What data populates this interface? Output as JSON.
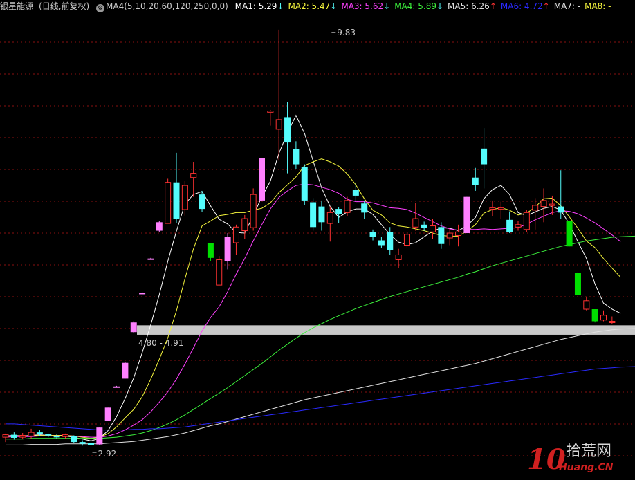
{
  "header": {
    "stock": "银星能源",
    "period": "(日线,前复权)",
    "gear_icon": "gear-icon",
    "params": "MA4(5,10,20,60,120,250,0,0)",
    "ma_items": [
      {
        "label": "MA1: 5.29",
        "arrow": "↓",
        "color": "#ffffff"
      },
      {
        "label": "MA2: 5.47",
        "arrow": "↓",
        "color": "#f5f53c"
      },
      {
        "label": "MA3: 5.62",
        "arrow": "↓",
        "color": "#ff40ff"
      },
      {
        "label": "MA4: 5.89",
        "arrow": "↓",
        "color": "#3cf03c"
      },
      {
        "label": "MA5: 6.26",
        "arrow": "↑",
        "color": "#e0e0e0"
      },
      {
        "label": "MA6: 4.72",
        "arrow": "↑",
        "color": "#2a2aff"
      },
      {
        "label": "MA7: -",
        "arrow": "",
        "color": "#e0e0e0"
      },
      {
        "label": "MA8: -",
        "arrow": "",
        "color": "#f5f53c"
      }
    ]
  },
  "chart_data": {
    "type": "candlestick",
    "ylim": [
      2.6,
      10.0
    ],
    "grid": true,
    "colors": {
      "up": "#ff3232",
      "down": "#54fcfc",
      "limit_up": "#ff80ff",
      "limit_down": "#00e000",
      "arrow_up": "#ff3232",
      "arrow_down": "#54fcfc",
      "band": "#c8c8c8",
      "annotation": "#c8c8c8"
    },
    "annotations": [
      {
        "label": "9.83",
        "value": 9.83,
        "candle": 38
      },
      {
        "label": "2.92",
        "value": 2.92,
        "candle": 10
      }
    ],
    "band": {
      "label": "4.80 - 4.91",
      "low": 4.8,
      "high": 4.91
    },
    "candles": [
      {
        "o": 3.08,
        "h": 3.14,
        "l": 3.0,
        "c": 3.12,
        "s": "up"
      },
      {
        "o": 3.12,
        "h": 3.16,
        "l": 3.04,
        "c": 3.07,
        "s": "down"
      },
      {
        "o": 3.08,
        "h": 3.15,
        "l": 3.05,
        "c": 3.11,
        "s": "up"
      },
      {
        "o": 3.1,
        "h": 3.22,
        "l": 3.06,
        "c": 3.16,
        "s": "up"
      },
      {
        "o": 3.16,
        "h": 3.2,
        "l": 3.1,
        "c": 3.13,
        "s": "down"
      },
      {
        "o": 3.13,
        "h": 3.14,
        "l": 3.08,
        "c": 3.11,
        "s": "down"
      },
      {
        "o": 3.1,
        "h": 3.13,
        "l": 3.05,
        "c": 3.08,
        "s": "down"
      },
      {
        "o": 3.09,
        "h": 3.14,
        "l": 3.06,
        "c": 3.12,
        "s": "up"
      },
      {
        "o": 3.1,
        "h": 3.11,
        "l": 2.98,
        "c": 3.0,
        "s": "down"
      },
      {
        "o": 3.0,
        "h": 3.03,
        "l": 2.94,
        "c": 2.97,
        "s": "down"
      },
      {
        "o": 2.98,
        "h": 3.0,
        "l": 2.92,
        "c": 2.95,
        "s": "down"
      },
      {
        "o": 2.96,
        "h": 3.24,
        "l": 2.95,
        "c": 3.24,
        "s": "limit_up"
      },
      {
        "o": 3.35,
        "h": 3.57,
        "l": 3.35,
        "c": 3.57,
        "s": "limit_up"
      },
      {
        "o": 3.92,
        "h": 3.93,
        "l": 3.9,
        "c": 3.92,
        "s": "limit_up"
      },
      {
        "o": 4.05,
        "h": 4.32,
        "l": 4.05,
        "c": 4.31,
        "s": "limit_up"
      },
      {
        "o": 4.82,
        "h": 5.0,
        "l": 4.8,
        "c": 4.98,
        "s": "limit_up"
      },
      {
        "o": 5.46,
        "h": 5.48,
        "l": 5.46,
        "c": 5.47,
        "s": "limit_up"
      },
      {
        "o": 6.02,
        "h": 6.05,
        "l": 6.02,
        "c": 6.04,
        "s": "limit_up"
      },
      {
        "o": 6.5,
        "h": 6.66,
        "l": 6.48,
        "c": 6.64,
        "s": "limit_up"
      },
      {
        "o": 6.62,
        "h": 7.36,
        "l": 6.62,
        "c": 7.3,
        "s": "up"
      },
      {
        "o": 7.3,
        "h": 7.79,
        "l": 6.63,
        "c": 6.7,
        "s": "down"
      },
      {
        "o": 6.85,
        "h": 7.33,
        "l": 6.75,
        "c": 7.25,
        "s": "up"
      },
      {
        "o": 7.38,
        "h": 7.64,
        "l": 7.06,
        "c": 7.45,
        "s": "up"
      },
      {
        "o": 7.1,
        "h": 7.16,
        "l": 6.81,
        "c": 6.86,
        "s": "down"
      },
      {
        "o": 6.05,
        "h": 6.3,
        "l": 6.0,
        "c": 6.3,
        "s": "limit_down"
      },
      {
        "o": 5.6,
        "h": 6.08,
        "l": 5.6,
        "c": 6.02,
        "s": "up"
      },
      {
        "o": 6.0,
        "h": 6.46,
        "l": 5.86,
        "c": 6.4,
        "s": "limit_up"
      },
      {
        "o": 6.3,
        "h": 6.6,
        "l": 6.1,
        "c": 6.56,
        "s": "up"
      },
      {
        "o": 6.5,
        "h": 6.76,
        "l": 6.36,
        "c": 6.7,
        "s": "up"
      },
      {
        "o": 6.55,
        "h": 7.2,
        "l": 6.5,
        "c": 7.1,
        "s": "up"
      },
      {
        "o": 7.0,
        "h": 7.7,
        "l": 7.0,
        "c": 7.7,
        "s": "limit_up"
      },
      {
        "o": 8.48,
        "h": 8.5,
        "l": 8.24,
        "c": 8.48,
        "s": "up"
      },
      {
        "o": 8.18,
        "h": 9.83,
        "l": 7.66,
        "c": 8.34,
        "s": "up"
      },
      {
        "o": 8.38,
        "h": 8.63,
        "l": 7.45,
        "c": 7.96,
        "s": "down"
      },
      {
        "o": 7.85,
        "h": 7.98,
        "l": 7.52,
        "c": 7.6,
        "s": "down"
      },
      {
        "o": 7.56,
        "h": 7.6,
        "l": 6.93,
        "c": 7.0,
        "s": "down"
      },
      {
        "o": 6.97,
        "h": 7.04,
        "l": 6.5,
        "c": 6.56,
        "s": "down"
      },
      {
        "o": 6.9,
        "h": 7.0,
        "l": 6.5,
        "c": 6.64,
        "s": "down"
      },
      {
        "o": 6.62,
        "h": 6.9,
        "l": 6.32,
        "c": 6.8,
        "s": "up"
      },
      {
        "o": 6.86,
        "h": 6.89,
        "l": 6.63,
        "c": 6.78,
        "s": "down"
      },
      {
        "o": 6.8,
        "h": 7.06,
        "l": 6.74,
        "c": 7.0,
        "s": "up"
      },
      {
        "o": 7.18,
        "h": 7.3,
        "l": 7.0,
        "c": 7.08,
        "s": "down"
      },
      {
        "o": 6.95,
        "h": 7.0,
        "l": 6.7,
        "c": 6.8,
        "s": "down"
      },
      {
        "o": 6.48,
        "h": 6.52,
        "l": 6.34,
        "c": 6.4,
        "s": "down"
      },
      {
        "o": 6.34,
        "h": 6.4,
        "l": 6.22,
        "c": 6.26,
        "s": "down"
      },
      {
        "o": 6.48,
        "h": 6.56,
        "l": 6.1,
        "c": 6.18,
        "s": "down"
      },
      {
        "o": 6.02,
        "h": 6.2,
        "l": 5.88,
        "c": 6.1,
        "s": "up"
      },
      {
        "o": 6.26,
        "h": 6.48,
        "l": 6.22,
        "c": 6.44,
        "s": "up"
      },
      {
        "o": 6.56,
        "h": 6.96,
        "l": 6.5,
        "c": 6.7,
        "s": "up"
      },
      {
        "o": 6.6,
        "h": 6.65,
        "l": 6.5,
        "c": 6.55,
        "s": "down"
      },
      {
        "o": 6.48,
        "h": 6.7,
        "l": 6.36,
        "c": 6.58,
        "s": "up"
      },
      {
        "o": 6.56,
        "h": 6.64,
        "l": 6.2,
        "c": 6.28,
        "s": "down"
      },
      {
        "o": 6.38,
        "h": 6.54,
        "l": 6.26,
        "c": 6.46,
        "s": "up"
      },
      {
        "o": 6.42,
        "h": 6.6,
        "l": 6.24,
        "c": 6.48,
        "s": "up"
      },
      {
        "o": 6.46,
        "h": 7.06,
        "l": 6.46,
        "c": 7.06,
        "s": "limit_up"
      },
      {
        "o": 7.38,
        "h": 7.54,
        "l": 7.16,
        "c": 7.26,
        "s": "down"
      },
      {
        "o": 7.6,
        "h": 8.2,
        "l": 7.2,
        "c": 7.86,
        "s": "down"
      },
      {
        "o": 6.88,
        "h": 7.0,
        "l": 6.74,
        "c": 6.86,
        "s": "up"
      },
      {
        "o": 6.86,
        "h": 6.98,
        "l": 6.7,
        "c": 6.88,
        "s": "up"
      },
      {
        "o": 6.68,
        "h": 6.82,
        "l": 6.46,
        "c": 6.48,
        "s": "down"
      },
      {
        "o": 6.56,
        "h": 6.66,
        "l": 6.5,
        "c": 6.6,
        "s": "up"
      },
      {
        "o": 6.52,
        "h": 6.84,
        "l": 6.48,
        "c": 6.8,
        "s": "up"
      },
      {
        "o": 6.84,
        "h": 7.04,
        "l": 6.52,
        "c": 6.92,
        "s": "up"
      },
      {
        "o": 6.9,
        "h": 7.2,
        "l": 6.64,
        "c": 7.0,
        "s": "up"
      },
      {
        "o": 6.92,
        "h": 7.08,
        "l": 6.76,
        "c": 6.94,
        "s": "up"
      },
      {
        "o": 6.9,
        "h": 7.5,
        "l": 6.7,
        "c": 6.8,
        "s": "down"
      },
      {
        "o": 6.66,
        "h": 6.66,
        "l": 6.24,
        "c": 6.24,
        "s": "limit_down"
      },
      {
        "o": 5.8,
        "h": 5.82,
        "l": 5.42,
        "c": 5.44,
        "s": "limit_down"
      },
      {
        "o": 5.2,
        "h": 5.4,
        "l": 5.18,
        "c": 5.34,
        "s": "up"
      },
      {
        "o": 5.2,
        "h": 5.2,
        "l": 4.98,
        "c": 5.0,
        "s": "limit_down"
      },
      {
        "o": 5.02,
        "h": 5.18,
        "l": 5.0,
        "c": 5.1,
        "s": "up"
      },
      {
        "o": 5.0,
        "h": 5.08,
        "l": 4.96,
        "c": 5.0,
        "s": "up"
      }
    ],
    "ma_lines": [
      {
        "name": "MA1",
        "color": "#ffffff",
        "values": [
          3.1,
          3.11,
          3.1,
          3.11,
          3.12,
          3.11,
          3.1,
          3.1,
          3.08,
          3.05,
          3.02,
          3.06,
          3.19,
          3.42,
          3.72,
          4.06,
          4.48,
          4.94,
          5.44,
          6.0,
          6.49,
          6.94,
          7.1,
          7.15,
          6.91,
          6.69,
          6.61,
          6.47,
          6.46,
          6.75,
          7.06,
          7.32,
          7.78,
          8.12,
          8.41,
          8.11,
          7.66,
          7.21,
          6.9,
          6.72,
          6.81,
          6.86,
          6.86,
          6.77,
          6.6,
          6.44,
          6.31,
          6.27,
          6.3,
          6.4,
          6.49,
          6.55,
          6.54,
          6.5,
          6.58,
          6.72,
          7.03,
          7.18,
          7.25,
          7.1,
          6.8,
          6.75,
          6.81,
          6.87,
          6.9,
          6.84,
          6.61,
          6.32,
          6.04,
          5.62,
          5.3,
          5.2,
          5.13
        ]
      },
      {
        "name": "MA2",
        "color": "#f5f53c",
        "values": [
          3.09,
          3.1,
          3.1,
          3.1,
          3.11,
          3.11,
          3.11,
          3.11,
          3.1,
          3.08,
          3.06,
          3.08,
          3.14,
          3.25,
          3.4,
          3.54,
          3.75,
          4.04,
          4.37,
          4.73,
          5.17,
          5.7,
          6.2,
          6.58,
          6.66,
          6.75,
          6.77,
          6.8,
          6.8,
          6.84,
          6.87,
          6.96,
          7.13,
          7.26,
          7.39,
          7.58,
          7.64,
          7.69,
          7.64,
          7.57,
          7.44,
          7.26,
          7.03,
          6.84,
          6.76,
          6.63,
          6.58,
          6.56,
          6.53,
          6.5,
          6.46,
          6.42,
          6.41,
          6.41,
          6.49,
          6.6,
          6.79,
          6.85,
          6.88,
          6.84,
          6.76,
          6.79,
          6.89,
          7.03,
          7.04,
          6.91,
          6.73,
          6.54,
          6.33,
          6.22,
          6.04,
          5.88,
          5.73
        ]
      },
      {
        "name": "MA3",
        "color": "#ff40ff",
        "values": [
          3.08,
          3.09,
          3.09,
          3.09,
          3.1,
          3.1,
          3.1,
          3.1,
          3.1,
          3.09,
          3.08,
          3.08,
          3.1,
          3.14,
          3.2,
          3.28,
          3.37,
          3.5,
          3.66,
          3.83,
          4.04,
          4.29,
          4.56,
          4.84,
          5.06,
          5.24,
          5.49,
          5.78,
          6.04,
          6.33,
          6.6,
          6.86,
          7.05,
          7.16,
          7.25,
          7.27,
          7.26,
          7.22,
          7.18,
          7.12,
          7.02,
          6.98,
          6.98,
          6.96,
          6.92,
          6.88,
          6.87,
          6.85,
          6.79,
          6.72,
          6.65,
          6.58,
          6.53,
          6.51,
          6.52,
          6.52,
          6.53,
          6.52,
          6.53,
          6.54,
          6.55,
          6.61,
          6.68,
          6.74,
          6.8,
          6.83,
          6.82,
          6.78,
          6.71,
          6.63,
          6.53,
          6.43,
          6.32
        ]
      },
      {
        "name": "MA4",
        "color": "#3cf03c",
        "values": [
          3.05,
          3.05,
          3.05,
          3.06,
          3.06,
          3.06,
          3.06,
          3.06,
          3.06,
          3.06,
          3.06,
          3.06,
          3.07,
          3.08,
          3.1,
          3.12,
          3.15,
          3.19,
          3.24,
          3.3,
          3.37,
          3.45,
          3.54,
          3.63,
          3.72,
          3.81,
          3.9,
          4.0,
          4.1,
          4.2,
          4.3,
          4.41,
          4.52,
          4.62,
          4.72,
          4.81,
          4.89,
          4.96,
          5.03,
          5.09,
          5.15,
          5.21,
          5.26,
          5.31,
          5.36,
          5.41,
          5.45,
          5.49,
          5.53,
          5.57,
          5.61,
          5.65,
          5.69,
          5.73,
          5.78,
          5.82,
          5.87,
          5.92,
          5.96,
          6.0,
          6.04,
          6.08,
          6.12,
          6.16,
          6.2,
          6.24,
          6.27,
          6.3,
          6.33,
          6.35,
          6.37,
          6.39,
          6.4
        ]
      },
      {
        "name": "MA5",
        "color": "#e0e0e0",
        "values": [
          2.95,
          2.95,
          2.95,
          2.96,
          2.96,
          2.96,
          2.96,
          2.97,
          2.97,
          2.97,
          2.97,
          2.97,
          2.98,
          2.99,
          3.0,
          3.01,
          3.03,
          3.05,
          3.07,
          3.09,
          3.12,
          3.15,
          3.19,
          3.23,
          3.27,
          3.3,
          3.34,
          3.38,
          3.42,
          3.46,
          3.5,
          3.54,
          3.58,
          3.62,
          3.66,
          3.7,
          3.73,
          3.76,
          3.79,
          3.82,
          3.85,
          3.88,
          3.91,
          3.94,
          3.97,
          4.0,
          4.03,
          4.06,
          4.09,
          4.12,
          4.15,
          4.18,
          4.21,
          4.24,
          4.27,
          4.3,
          4.34,
          4.38,
          4.42,
          4.46,
          4.5,
          4.54,
          4.58,
          4.62,
          4.66,
          4.7,
          4.73,
          4.76,
          4.79,
          4.82,
          4.84,
          4.86,
          4.87
        ]
      },
      {
        "name": "MA6",
        "color": "#2a2aff",
        "values": [
          3.3,
          3.3,
          3.29,
          3.28,
          3.27,
          3.26,
          3.25,
          3.24,
          3.23,
          3.22,
          3.21,
          3.2,
          3.2,
          3.2,
          3.2,
          3.21,
          3.21,
          3.22,
          3.22,
          3.23,
          3.24,
          3.25,
          3.27,
          3.29,
          3.31,
          3.33,
          3.35,
          3.37,
          3.39,
          3.41,
          3.43,
          3.45,
          3.47,
          3.49,
          3.51,
          3.53,
          3.55,
          3.57,
          3.59,
          3.61,
          3.63,
          3.65,
          3.67,
          3.69,
          3.71,
          3.73,
          3.75,
          3.77,
          3.79,
          3.81,
          3.83,
          3.85,
          3.87,
          3.89,
          3.91,
          3.93,
          3.95,
          3.97,
          3.99,
          4.01,
          4.03,
          4.05,
          4.07,
          4.09,
          4.11,
          4.13,
          4.15,
          4.17,
          4.19,
          4.21,
          4.22,
          4.23,
          4.24
        ]
      }
    ]
  },
  "watermark": {
    "ten": "10",
    "cn": "拾荒网",
    "en": "Huang.CN"
  }
}
